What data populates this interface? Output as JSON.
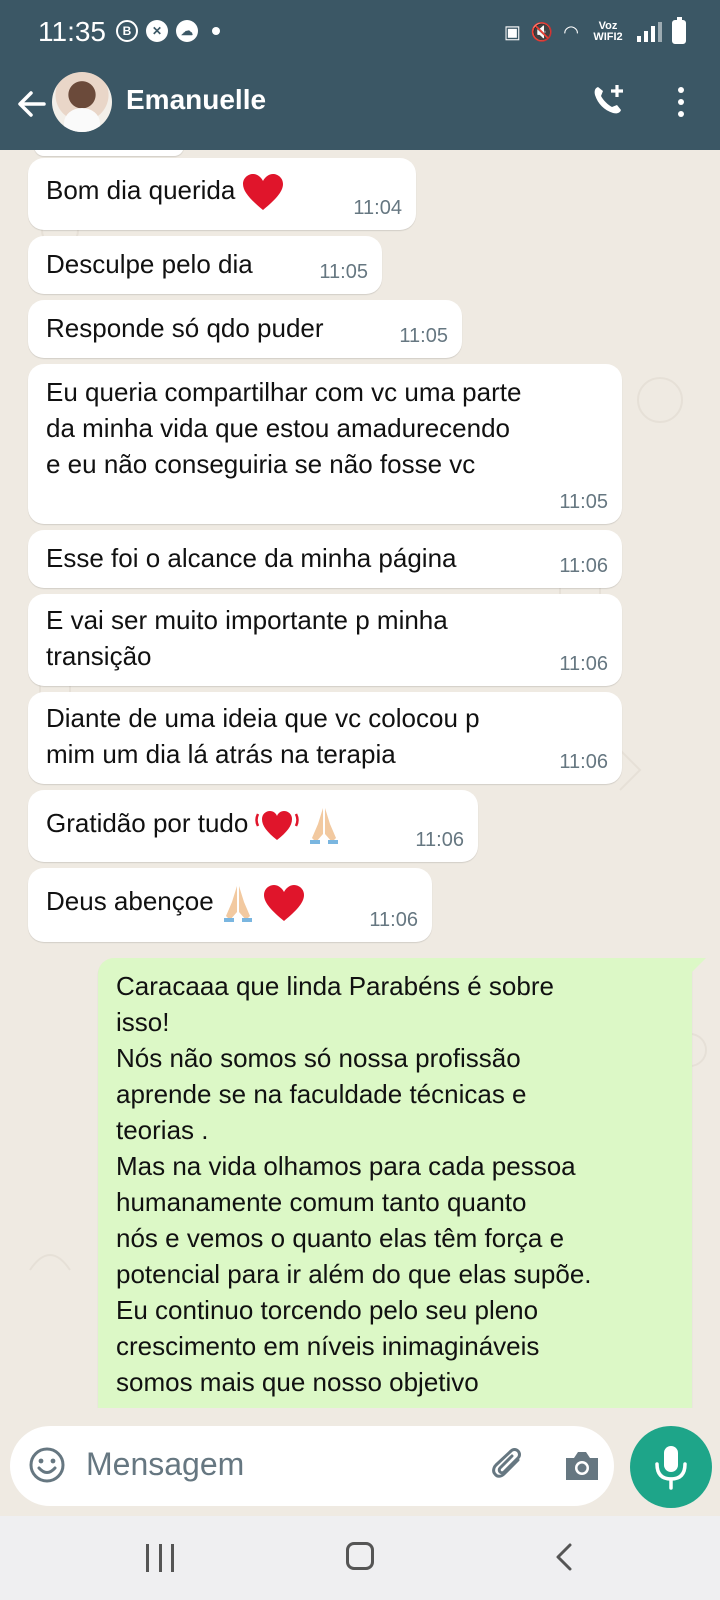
{
  "status_bar": {
    "time": "11:35",
    "network_label": "Voz WIFI2"
  },
  "header": {
    "contact_name": "Emanuelle",
    "color": "#3b5765"
  },
  "messages": [
    {
      "direction": "in",
      "text": "Bom dia querida",
      "emoji": "heart",
      "time": "11:04"
    },
    {
      "direction": "in",
      "text": "Desculpe pelo dia",
      "time": "11:05"
    },
    {
      "direction": "in",
      "text": "Responde só qdo puder",
      "time": "11:05"
    },
    {
      "direction": "in",
      "text": "Eu queria compartilhar com vc uma parte\nda minha vida que estou amadurecendo\ne eu não conseguiria se não fosse vc",
      "time": "11:05"
    },
    {
      "direction": "in",
      "text": "Esse foi o alcance da minha página",
      "time": "11:06"
    },
    {
      "direction": "in",
      "text": "E vai ser muito importante p minha\ntransição",
      "time": "11:06"
    },
    {
      "direction": "in",
      "text": "Diante de uma ideia que vc colocou p\nmim um dia lá atrás na terapia",
      "time": "11:06"
    },
    {
      "direction": "in",
      "text": "Gratidão por tudo",
      "emoji": "vibrating-heart praying-hands",
      "time": "11:06"
    },
    {
      "direction": "in",
      "text": "Deus abençoe",
      "emoji": "praying-hands heart",
      "time": "11:06"
    },
    {
      "direction": "out",
      "text": "Caracaaa que linda Parabéns é sobre\nisso!\nNós não somos só nossa profissão\naprende se na faculdade técnicas e\nteorias .\nMas na vida olhamos para cada pessoa\nhumanamente comum tanto quanto\nnós e  vemos o quanto elas têm força e\npotencial para ir além do que elas supõe.\nEu continuo torcendo pelo seu pleno\ncrescimento em níveis inimagináveis\nsomos mais que nosso objetivo"
    }
  ],
  "composer": {
    "placeholder": "Mensagem"
  },
  "colors": {
    "incoming_bubble": "#ffffff",
    "outgoing_bubble": "#dcf8c6",
    "mic_button": "#1ea589",
    "chat_background": "#efeae2"
  }
}
